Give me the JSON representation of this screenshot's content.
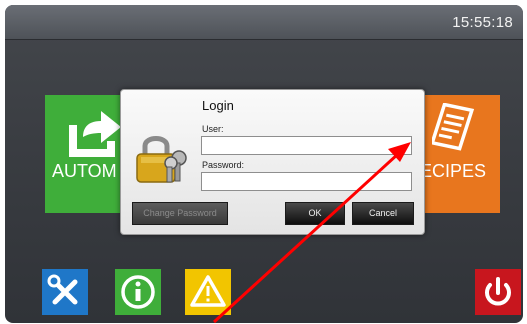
{
  "status_bar": {
    "time": "15:55:18"
  },
  "tiles": {
    "automatic": {
      "label": "AUTOM",
      "icon": "export-arrow-icon"
    },
    "recipes": {
      "label": "ECIPES",
      "icon": "recipe-document-icon"
    }
  },
  "login_dialog": {
    "title": "Login",
    "user_label": "User:",
    "user_value": "",
    "password_label": "Password:",
    "password_value": "",
    "change_password_label": "Change Password",
    "ok_label": "OK",
    "cancel_label": "Cancel",
    "icon": "padlock-keys-icon"
  },
  "bottom_bar": [
    {
      "name": "tools",
      "icon": "wrench-screwdriver-icon",
      "color": "#1f77c8"
    },
    {
      "name": "info",
      "icon": "info-icon",
      "color": "#3fae3a"
    },
    {
      "name": "warning",
      "icon": "warning-icon",
      "color": "#f2c500"
    },
    {
      "name": "power",
      "icon": "power-icon",
      "color": "#c8161e"
    }
  ],
  "annotation": {
    "icon": "red-arrow-annotation",
    "color": "#ff0000"
  }
}
